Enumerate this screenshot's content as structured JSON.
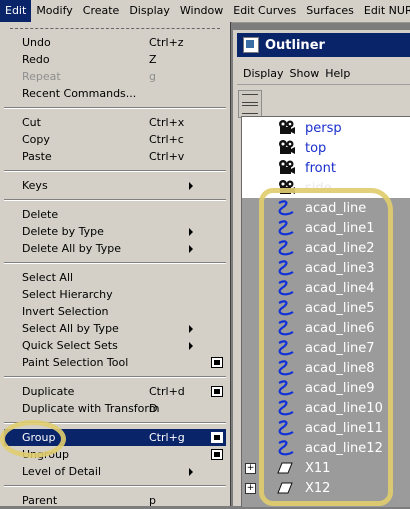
{
  "menubar": {
    "items": [
      {
        "label": "Edit",
        "active": true
      },
      {
        "label": "Modify"
      },
      {
        "label": "Create"
      },
      {
        "label": "Display"
      },
      {
        "label": "Window"
      },
      {
        "label": "Edit Curves"
      },
      {
        "label": "Surfaces"
      },
      {
        "label": "Edit NURBS"
      }
    ]
  },
  "edit_menu": {
    "items": [
      {
        "label": "Undo",
        "shortcut": "Ctrl+z"
      },
      {
        "label": "Redo",
        "shortcut": "Z"
      },
      {
        "label": "Repeat",
        "shortcut": "g",
        "disabled": true
      },
      {
        "label": "Recent Commands..."
      },
      {
        "separator": true
      },
      {
        "label": "Cut",
        "shortcut": "Ctrl+x"
      },
      {
        "label": "Copy",
        "shortcut": "Ctrl+c"
      },
      {
        "label": "Paste",
        "shortcut": "Ctrl+v"
      },
      {
        "separator": true
      },
      {
        "label": "Keys",
        "submenu": true
      },
      {
        "separator": true
      },
      {
        "label": "Delete"
      },
      {
        "label": "Delete by Type",
        "submenu": true
      },
      {
        "label": "Delete All by Type",
        "submenu": true
      },
      {
        "separator": true
      },
      {
        "label": "Select All"
      },
      {
        "label": "Select Hierarchy"
      },
      {
        "label": "Invert Selection"
      },
      {
        "label": "Select All by Type",
        "submenu": true
      },
      {
        "label": "Quick Select Sets",
        "submenu": true
      },
      {
        "label": "Paint Selection Tool",
        "option_box": true
      },
      {
        "separator": true
      },
      {
        "label": "Duplicate",
        "shortcut": "Ctrl+d",
        "option_box": true
      },
      {
        "label": "Duplicate with Transform",
        "shortcut": "D"
      },
      {
        "separator": true
      },
      {
        "label": "Group",
        "shortcut": "Ctrl+g",
        "option_box": true,
        "selected": true
      },
      {
        "label": "Ungroup",
        "option_box": true
      },
      {
        "label": "Level of Detail",
        "submenu": true
      },
      {
        "separator": true
      },
      {
        "label": "Parent",
        "shortcut": "p"
      }
    ]
  },
  "outliner": {
    "title": "Outliner",
    "menu": [
      "Display",
      "Show",
      "Help"
    ],
    "rows": [
      {
        "label": "persp",
        "kind": "camera"
      },
      {
        "label": "top",
        "kind": "camera"
      },
      {
        "label": "front",
        "kind": "camera"
      },
      {
        "label": "side",
        "kind": "camera",
        "selected": true
      },
      {
        "label": "acad_line",
        "kind": "curve",
        "selected": true
      },
      {
        "label": "acad_line1",
        "kind": "curve",
        "selected": true
      },
      {
        "label": "acad_line2",
        "kind": "curve",
        "selected": true
      },
      {
        "label": "acad_line3",
        "kind": "curve",
        "selected": true
      },
      {
        "label": "acad_line4",
        "kind": "curve",
        "selected": true
      },
      {
        "label": "acad_line5",
        "kind": "curve",
        "selected": true
      },
      {
        "label": "acad_line6",
        "kind": "curve",
        "selected": true
      },
      {
        "label": "acad_line7",
        "kind": "curve",
        "selected": true
      },
      {
        "label": "acad_line8",
        "kind": "curve",
        "selected": true
      },
      {
        "label": "acad_line9",
        "kind": "curve",
        "selected": true
      },
      {
        "label": "acad_line10",
        "kind": "curve",
        "selected": true
      },
      {
        "label": "acad_line11",
        "kind": "curve",
        "selected": true
      },
      {
        "label": "acad_line12",
        "kind": "curve",
        "selected": true
      },
      {
        "label": "X11",
        "kind": "transform",
        "expandable": true,
        "selected": true
      },
      {
        "label": "X12",
        "kind": "transform",
        "expandable": true,
        "selected": true
      }
    ]
  },
  "colors": {
    "menu_bg": "#d4d0c8",
    "selection": "#0a246a",
    "camera_text": "#1a2ecc",
    "curve_icon": "#1030d8",
    "annotation": "#e0cd6e"
  }
}
